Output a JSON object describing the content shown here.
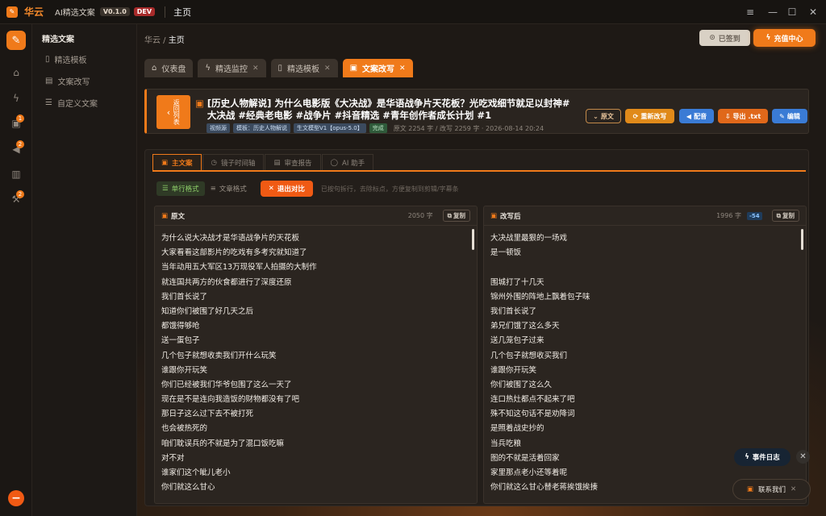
{
  "titlebar": {
    "brand": "华云",
    "app_name": "AI精选文案",
    "version": "V0.1.0",
    "env": "DEV",
    "home": "主页"
  },
  "rail": {
    "badges": [
      "1",
      "2",
      "2"
    ]
  },
  "sidebar": {
    "title": "精选文案",
    "items": [
      {
        "label": "精选模板",
        "icon": "bookmark-icon"
      },
      {
        "label": "文案改写",
        "icon": "doc-edit-icon"
      },
      {
        "label": "自定义文案",
        "icon": "sliders-icon"
      }
    ]
  },
  "breadcrumb": {
    "root": "华云",
    "current": "主页"
  },
  "top_buttons": {
    "signed": "已签到",
    "charge": "充值中心"
  },
  "tabs": [
    {
      "label": "仪表盘",
      "icon": "home-icon",
      "closable": false
    },
    {
      "label": "精选监控",
      "icon": "bolt-icon",
      "closable": true
    },
    {
      "label": "精选模板",
      "icon": "bookmark-icon",
      "closable": true
    },
    {
      "label": "文案改写",
      "icon": "doc-edit-icon",
      "closable": true,
      "active": true
    }
  ],
  "header": {
    "back_label": "返回列表",
    "title": "[历史人物解说] 为什么电影版《大决战》是华语战争片天花板？光吃戏细节就足以封神#大决战 #经典老电影 #战争片 #抖音精选 #青年创作者成长计划 #1",
    "tags": [
      "视频源",
      "模板：历史人物解说",
      "生文模型V1【opus-5.0】"
    ],
    "status": "完成",
    "info": "原文 2254 字 / 改写 2259 字 · 2026-08-14 20:24",
    "buttons": {
      "original": "原文",
      "regenerate": "重新改写",
      "dub": "配音",
      "export": "导出 .txt",
      "edit": "编辑"
    }
  },
  "panel_tabs": [
    "主文案",
    "镜子时间轴",
    "审查报告",
    "AI 助手"
  ],
  "toolbar": {
    "single_line": "单行格式",
    "article": "文章格式",
    "exit_compare": "退出对比",
    "hint": "已按句拆行，去除标点，方便复制到剪辑/字幕条"
  },
  "columns": {
    "original": {
      "title": "原文",
      "count": "2050 字",
      "copy": "复制",
      "lines": [
        "为什么说大决战才是华语战争片的天花板",
        "大家看看这部影片的吃戏有多考究就知道了",
        "当年动用五大军区13万现役军人拍摄的大制作",
        "就连国共两方的伙食都进行了深度还原",
        "我们首长说了",
        "知道你们被围了好几天之后",
        "都饿得够呛",
        "送一蛋包子",
        "几个包子就想收卖我们开什么玩笑",
        "谁跟你开玩笑",
        "你们已经被我们华爷包围了这么一天了",
        "现在是不是连向我造饭的财物都没有了吧",
        "那日子这么过下去不被打死",
        "也会被热死的",
        "咱们耽误兵的不就是为了混口饭吃嘛",
        "对不对",
        "谁家们这个眦儿老小",
        "你们就这么甘心"
      ]
    },
    "rewritten": {
      "title": "改写后",
      "count": "1996 字",
      "diff": "-54",
      "copy": "复制",
      "lines": [
        "大决战里最狠的一场戏",
        "是一顿饭",
        "",
        "围城打了十几天",
        "锦州外围的阵地上飘着包子味",
        "我们首长说了",
        "弟兄们饿了这么多天",
        "送几笼包子过来",
        "几个包子就想收买我们",
        "谁跟你开玩笑",
        "你们被围了这么久",
        "连口热灶都点不起来了吧",
        "殊不知这句话不是劝降词",
        "是照着战史抄的",
        "当兵吃粮",
        "图的不就是活着回家",
        "家里那点老小还等着呢",
        "你们就这么甘心替老蒋挨饿挨揍"
      ]
    }
  },
  "floating": {
    "event_log": "事件日志",
    "contact": "联系我们"
  },
  "colors": {
    "accent": "#f07a1a",
    "danger": "#f05a14",
    "blue": "#3a7bd5"
  }
}
